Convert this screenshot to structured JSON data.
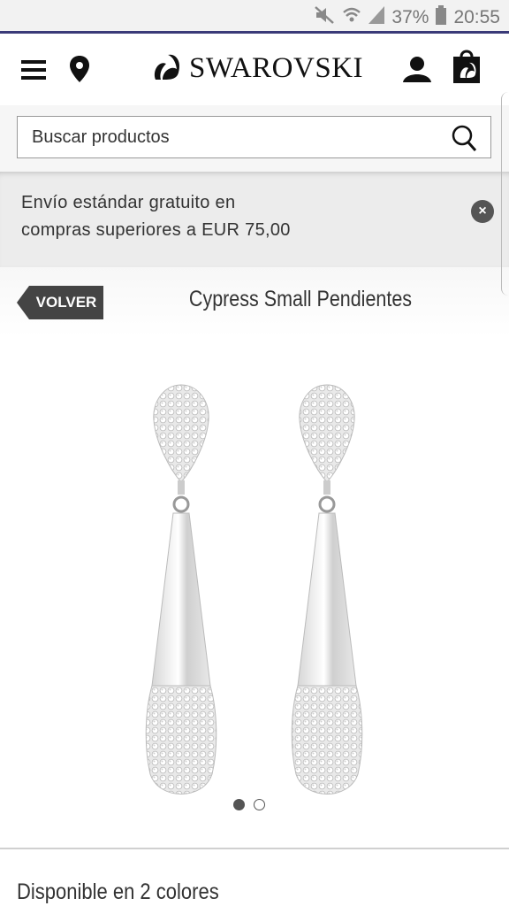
{
  "status_bar": {
    "battery": "37%",
    "time": "20:55",
    "icons": [
      "mute-icon",
      "wifi-icon",
      "signal-icon",
      "battery-icon"
    ]
  },
  "header": {
    "brand": "SWAROVSKI",
    "icons": [
      "menu-icon",
      "location-pin-icon",
      "swan-logo-icon",
      "user-icon",
      "shopping-bag-icon"
    ]
  },
  "search": {
    "placeholder": "Buscar productos"
  },
  "promo": {
    "line1": "Envío estándar gratuito en",
    "line2": "compras superiores a EUR 75,00"
  },
  "titlebar": {
    "back_label": "VOLVER",
    "title": "Cypress Small Pendientes"
  },
  "carousel": {
    "total": 2,
    "active": 1
  },
  "colors": {
    "title": "Disponible en 2 colores"
  },
  "theme": {
    "accent": "#3a3a78",
    "dark": "#444444"
  }
}
